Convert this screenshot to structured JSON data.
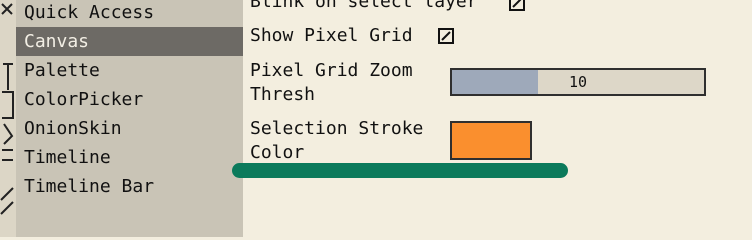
{
  "sidebar": {
    "items": [
      {
        "label": "Quick Access",
        "active": false
      },
      {
        "label": "Canvas",
        "active": true
      },
      {
        "label": "Palette",
        "active": false
      },
      {
        "label": "ColorPicker",
        "active": false
      },
      {
        "label": "OnionSkin",
        "active": false
      },
      {
        "label": "Timeline",
        "active": false
      },
      {
        "label": "Timeline Bar",
        "active": false
      }
    ]
  },
  "settings": {
    "blink_label": "Blink on select layer",
    "blink_checked": true,
    "show_grid_label": "Show Pixel Grid",
    "show_grid_checked": true,
    "grid_zoom_label_line1": "Pixel Grid Zoom",
    "grid_zoom_label_line2": "Thresh",
    "grid_zoom_value": "10",
    "grid_zoom_fraction": 0.34,
    "stroke_color_label_line1": "Selection Stroke",
    "stroke_color_label_line2": "Color",
    "stroke_color": "#fa8f2e"
  },
  "annotation": {
    "color": "#0b7a5b"
  }
}
